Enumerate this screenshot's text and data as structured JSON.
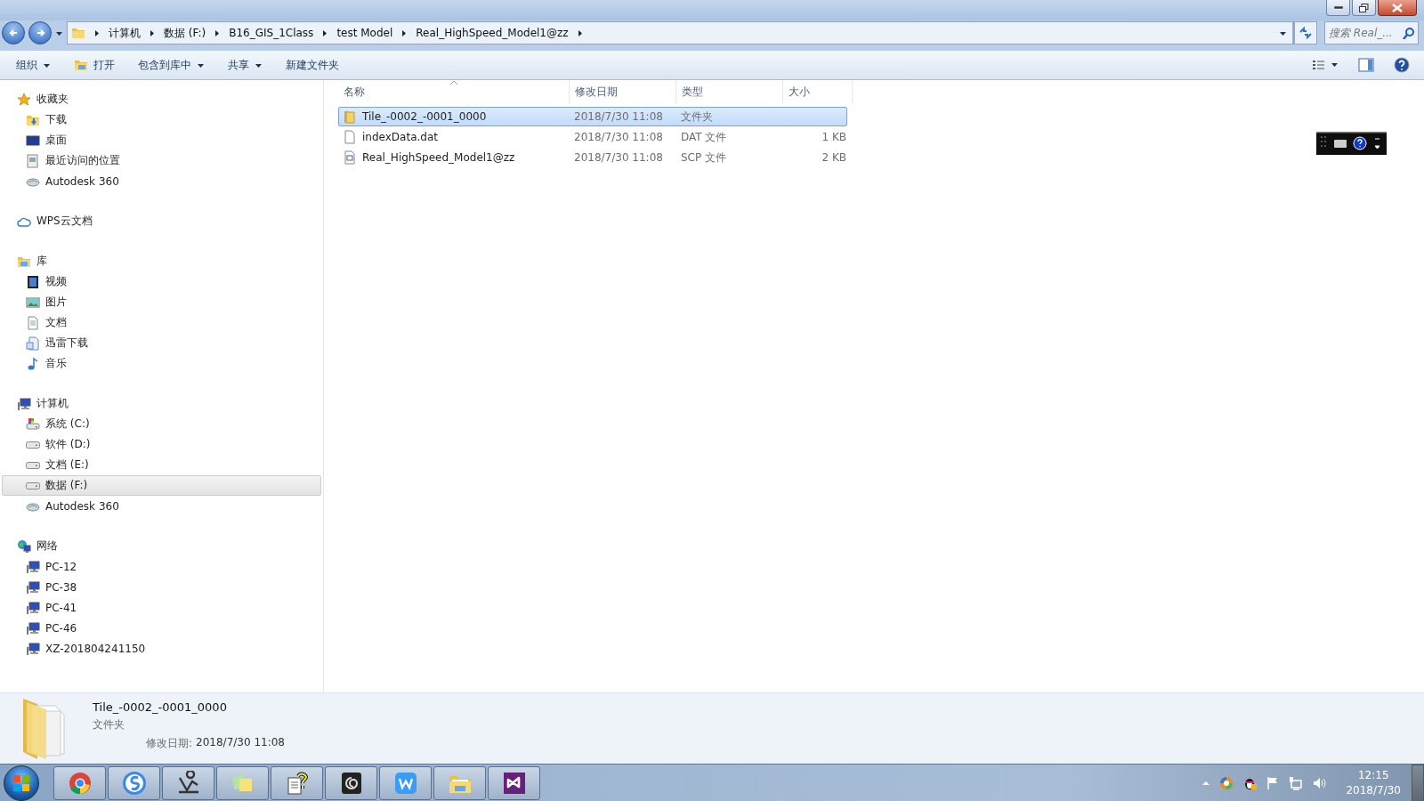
{
  "address_bar": {
    "crumbs": [
      "计算机",
      "数据 (F:)",
      "B16_GIS_1Class",
      "test Model",
      "Real_HighSpeed_Model1@zz"
    ],
    "search": {
      "placeholder": "搜索 Real_..."
    }
  },
  "toolbar": {
    "items": [
      {
        "label": "组织",
        "kind": "dropdown"
      },
      {
        "label": "打开",
        "kind": "icon"
      },
      {
        "label": "包含到库中",
        "kind": "dropdown"
      },
      {
        "label": "共享",
        "kind": "dropdown"
      },
      {
        "label": "新建文件夹",
        "kind": "plain"
      }
    ]
  },
  "sidebar": {
    "groups": [
      {
        "label": "收藏夹",
        "kind": "star",
        "selected": false,
        "children": [
          {
            "label": "下载",
            "kind": "downloads",
            "selected": false
          },
          {
            "label": "桌面",
            "kind": "desktop",
            "selected": false
          },
          {
            "label": "最近访问的位置",
            "kind": "recent",
            "selected": false
          },
          {
            "label": "Autodesk 360",
            "kind": "autodesk",
            "selected": false
          }
        ]
      },
      {
        "label": "WPS云文档",
        "kind": "cloud",
        "selected": false
      },
      {
        "label": "库",
        "kind": "library",
        "selected": false,
        "children": [
          {
            "label": "视频",
            "kind": "video",
            "selected": false
          },
          {
            "label": "图片",
            "kind": "picture",
            "selected": false
          },
          {
            "label": "文档",
            "kind": "document",
            "selected": false
          },
          {
            "label": "迅雷下载",
            "kind": "xunlei",
            "selected": false
          },
          {
            "label": "音乐",
            "kind": "music",
            "selected": false
          }
        ]
      },
      {
        "label": "计算机",
        "kind": "computer",
        "selected": false,
        "children": [
          {
            "label": "系统 (C:)",
            "kind": "system-drive",
            "selected": false
          },
          {
            "label": "软件 (D:)",
            "kind": "drive",
            "selected": false
          },
          {
            "label": "文档 (E:)",
            "kind": "drive",
            "selected": false
          },
          {
            "label": "数据 (F:)",
            "kind": "drive",
            "selected": true
          },
          {
            "label": "Autodesk 360",
            "kind": "autodesk",
            "selected": false
          }
        ]
      },
      {
        "label": "网络",
        "kind": "network",
        "selected": false,
        "children": [
          {
            "label": "PC-12",
            "kind": "pc",
            "selected": false
          },
          {
            "label": "PC-38",
            "kind": "pc",
            "selected": false
          },
          {
            "label": "PC-41",
            "kind": "pc",
            "selected": false
          },
          {
            "label": "PC-46",
            "kind": "pc",
            "selected": false
          },
          {
            "label": "XZ-201804241150",
            "kind": "pc",
            "selected": false
          }
        ]
      }
    ]
  },
  "file_list": {
    "columns": [
      {
        "label": "名称",
        "sorted": true
      },
      {
        "label": "修改日期",
        "sorted": false
      },
      {
        "label": "类型",
        "sorted": false
      },
      {
        "label": "大小",
        "sorted": false
      }
    ],
    "rows": [
      {
        "name": "Tile_-0002_-0001_0000",
        "kind": "folder",
        "date": "2018/7/30 11:08",
        "type": "文件夹",
        "size": "",
        "selected": true
      },
      {
        "name": "indexData.dat",
        "kind": "file",
        "date": "2018/7/30 11:08",
        "type": "DAT 文件",
        "size": "1 KB",
        "selected": false
      },
      {
        "name": "Real_HighSpeed_Model1@zz",
        "kind": "script",
        "date": "2018/7/30 11:08",
        "type": "SCP 文件",
        "size": "2 KB",
        "selected": false
      }
    ]
  },
  "details": {
    "name": "Tile_-0002_-0001_0000",
    "type": "文件夹",
    "date_label": "修改日期:",
    "date": "2018/7/30 11:08"
  },
  "clock": {
    "time": "12:15",
    "date": "2018/7/30"
  }
}
